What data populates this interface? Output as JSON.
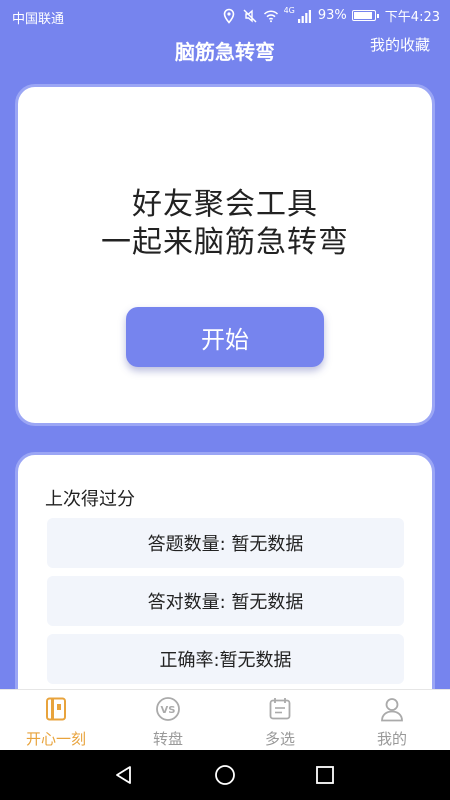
{
  "status_bar": {
    "carrier": "中国联通",
    "network": "4G",
    "battery": "93%",
    "battery_level": 0.93,
    "time": "下午4:23"
  },
  "header": {
    "title": "脑筋急转弯",
    "favorites_label": "我的收藏"
  },
  "hero": {
    "line1": "好友聚会工具",
    "line2": "一起来脑筋急转弯",
    "start_label": "开始"
  },
  "last_score": {
    "title": "上次得过分",
    "rows": [
      "答题数量: 暂无数据",
      "答对数量: 暂无数据",
      "正确率:暂无数据"
    ]
  },
  "tabs": [
    {
      "label": "开心一刻",
      "icon": "book-icon",
      "active": true
    },
    {
      "label": "转盘",
      "icon": "vs-icon",
      "active": false
    },
    {
      "label": "多选",
      "icon": "calendar-icon",
      "active": false
    },
    {
      "label": "我的",
      "icon": "user-icon",
      "active": false
    }
  ],
  "colors": {
    "primary": "#7684ee",
    "tab_active": "#e8a33c",
    "tab_inactive": "#999999"
  }
}
